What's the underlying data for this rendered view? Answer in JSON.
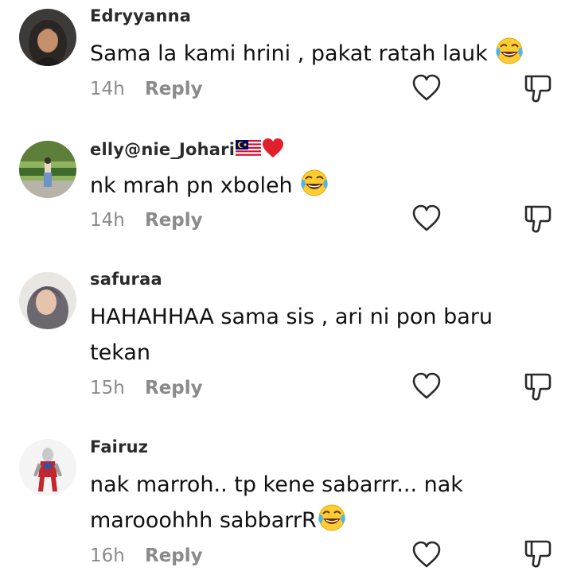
{
  "comments": [
    {
      "username": "Edryyanna",
      "username_emoji": "",
      "text": "Sama la kami hrini , pakat ratah lauk",
      "text_emoji": "face-with-tears-of-joy",
      "time": "14h",
      "reply": "Reply"
    },
    {
      "username": "elly@nie_Johari",
      "username_emoji": "malaysia-flag, red-heart",
      "text": "nk mrah pn xboleh",
      "text_emoji": "face-with-tears-of-joy",
      "time": "14h",
      "reply": "Reply"
    },
    {
      "username": "safuraa",
      "username_emoji": "",
      "text": "HAHAHHAA sama sis , ari ni pon baru tekan",
      "text_emoji": "",
      "time": "15h",
      "reply": "Reply"
    },
    {
      "username": "Fairuz",
      "username_emoji": "",
      "text": "nak marroh.. tp kene sabarrr... nak marooohhh sabbarrR",
      "text_emoji": "face-with-tears-of-joy",
      "time": "16h",
      "reply": "Reply"
    }
  ],
  "icons": {
    "like": "heart-outline-icon",
    "dislike": "thumbs-down-outline-icon"
  },
  "colors": {
    "meta_text": "#8a8a8a",
    "username": "#2b2b2b",
    "comment_text": "#111111"
  }
}
